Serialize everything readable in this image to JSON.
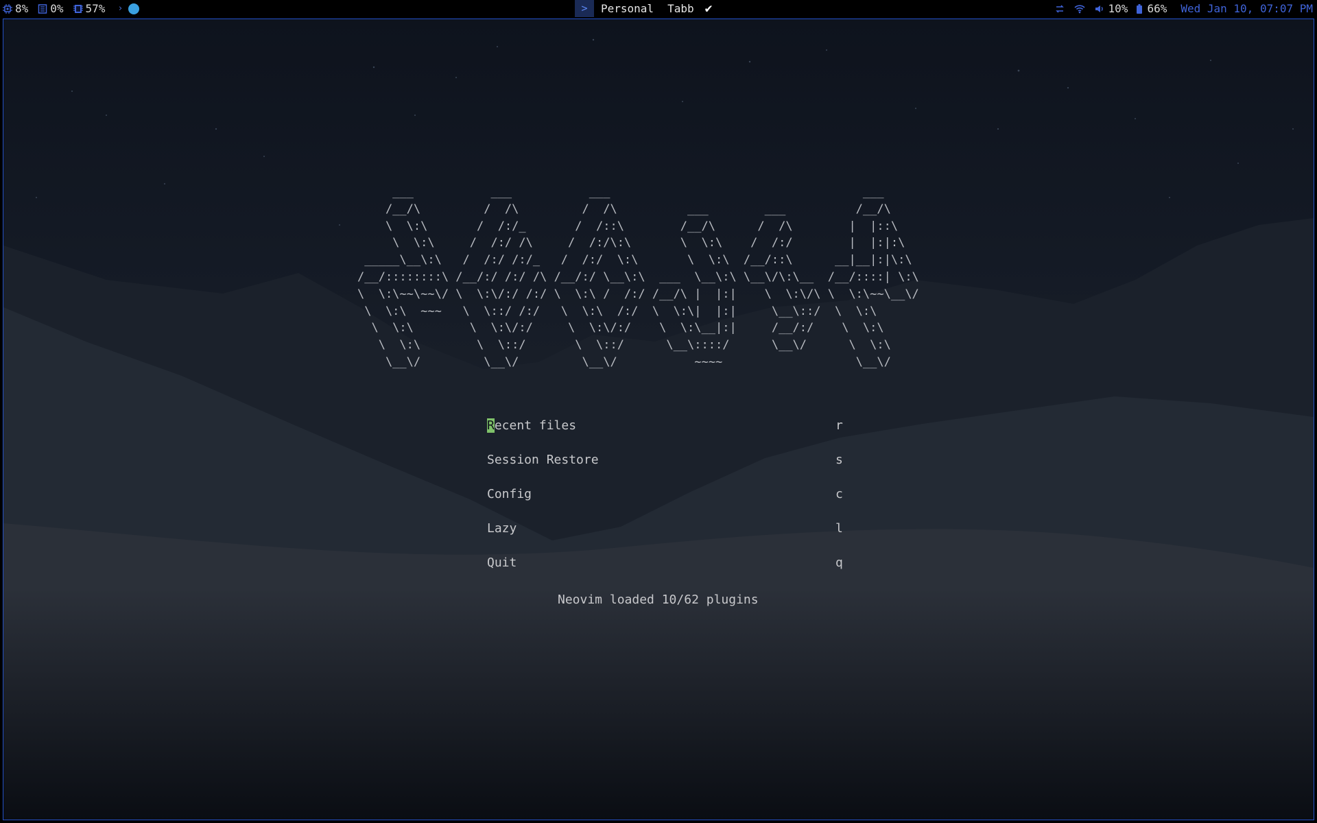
{
  "statusbar": {
    "cpu": "8%",
    "disk": "0%",
    "memory": "57%",
    "workspace_prompt": ">",
    "workspaces": [
      "Personal",
      "Tabb"
    ],
    "check": "✔",
    "volume": "10%",
    "battery": "66%",
    "clock": "Wed Jan 10, 07:07 PM",
    "icons": [
      "cpu-icon",
      "disk-icon",
      "memory-icon",
      "chevron-right-icon",
      "status-dot-icon",
      "network-transfer-icon",
      "wifi-icon",
      "volume-icon",
      "battery-icon"
    ],
    "accent": "#2451c9"
  },
  "dashboard": {
    "logo_lines": [
      "     ___           ___           ___                                    ___     ",
      "    /__/\\         /  /\\         /  /\\          ___        ___          /__/\\    ",
      "    \\  \\:\\       /  /:/_       /  /::\\        /__/\\      /  /\\        |  |::\\   ",
      "     \\  \\:\\     /  /:/ /\\     /  /:/\\:\\       \\  \\:\\    /  /:/        |  |:|:\\  ",
      " _____\\__\\:\\   /  /:/ /:/_   /  /:/  \\:\\       \\  \\:\\  /__/::\\      __|__|:|\\:\\ ",
      "/__/::::::::\\ /__/:/ /:/ /\\ /__/:/ \\__\\:\\  ___  \\__\\:\\ \\__\\/\\:\\__  /__/::::| \\:\\",
      "\\  \\:\\~~\\~~\\/ \\  \\:\\/:/ /:/ \\  \\:\\ /  /:/ /__/\\ |  |:|    \\  \\:\\/\\ \\  \\:\\~~\\__\\/",
      " \\  \\:\\  ~~~   \\  \\::/ /:/   \\  \\:\\  /:/  \\  \\:\\|  |:|     \\__\\::/  \\  \\:\\      ",
      "  \\  \\:\\        \\  \\:\\/:/     \\  \\:\\/:/    \\  \\:\\__|:|     /__/:/    \\  \\:\\     ",
      "   \\  \\:\\        \\  \\::/       \\  \\::/      \\__\\::::/      \\__\\/      \\  \\:\\    ",
      "    \\__\\/         \\__\\/         \\__\\/           ~~~~                   \\__\\/    "
    ],
    "menu": [
      {
        "label": "Recent files",
        "key": "r"
      },
      {
        "label": "Session Restore",
        "key": "s"
      },
      {
        "label": "Config",
        "key": "c"
      },
      {
        "label": "Lazy",
        "key": "l"
      },
      {
        "label": "Quit",
        "key": "q"
      }
    ],
    "footer": "Neovim loaded 10/62 plugins",
    "cursor_color": "#7fc16a"
  }
}
